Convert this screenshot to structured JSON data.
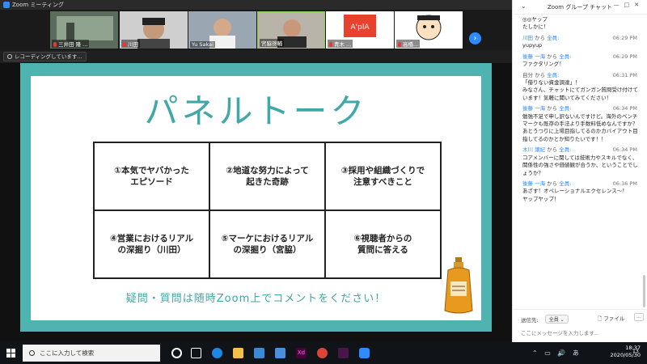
{
  "window": {
    "title": "Zoom ミーティング"
  },
  "participants": [
    {
      "name": "三井田 隆 ..."
    },
    {
      "name": "川田"
    },
    {
      "name": "Yu Sakai"
    },
    {
      "name": "宮脇啓輔"
    },
    {
      "name": "青木  ..."
    },
    {
      "name": "高橋..."
    }
  ],
  "recording": {
    "label": "レコーディングしています..."
  },
  "slide": {
    "title": "パネルトーク",
    "cells": [
      "①本気でヤバかった\nエピソード",
      "②地道な努力によって\n起きた奇跡",
      "③採用や組織づくりで\n注意すべきこと",
      "④営業におけるリアル\nの深掘り（川田）",
      "⑤マーケにおけるリアル\nの深掘り（宮脇）",
      "⑥視聴者からの\n質問に答える"
    ],
    "footer": "疑問・質問は随時Zoom上でコメントをください！",
    "colors": {
      "border": "#4fb3b1",
      "title": "#40a9a8"
    }
  },
  "chat": {
    "title": "Zoom グループ チャット",
    "messages": [
      {
        "from": "",
        "to": "",
        "time": "",
        "text": "◎◎ヤップ\nたしかに！"
      },
      {
        "from": "川田",
        "to": "全員",
        "time": "06:29 PM",
        "text": "yupyup"
      },
      {
        "from": "後藤 一海",
        "to": "全員",
        "time": "06:29 PM",
        "text": "ファクタリング！"
      },
      {
        "from": "自分",
        "to": "全員",
        "time": "06:31 PM",
        "text": "「借りない資金調達」！\nみなさん、チャットにてガンガン質問受け付けています！気軽に聞いてみてください！"
      },
      {
        "from": "後藤 一海",
        "to": "全員",
        "time": "06:34 PM",
        "text": "勉強不足で申し訳ないんですけど。海外のベンチマークも既存の手法より手数料低めなんですか？\nあとうつりに上場目指してるのかカバイアウト目指してるのかとか知りたいです！！"
      },
      {
        "from": "木川 譲紀",
        "to": "全員",
        "time": "06:34 PM",
        "text": "コアメンバーに関しては技術力やスキルでなく、関係性の強さや価値観が合うか、ということでしょうか？"
      },
      {
        "from": "後藤 一海",
        "to": "全員",
        "time": "06:36 PM",
        "text": "あざす！オペレーショナルエクセレンス～！\nヤップヤップ！"
      }
    ],
    "from_sep": "から",
    "sendto_label": "送信先:",
    "sendto_value": "全員",
    "file_label": "ファイル",
    "more_label": "...",
    "input_placeholder": "ここにメッセージを入力します..."
  },
  "taskbar": {
    "search_placeholder": "ここに入力して検索",
    "time": "18:37",
    "date": "2020/05/30",
    "ime": "あ",
    "notifications": "13"
  }
}
